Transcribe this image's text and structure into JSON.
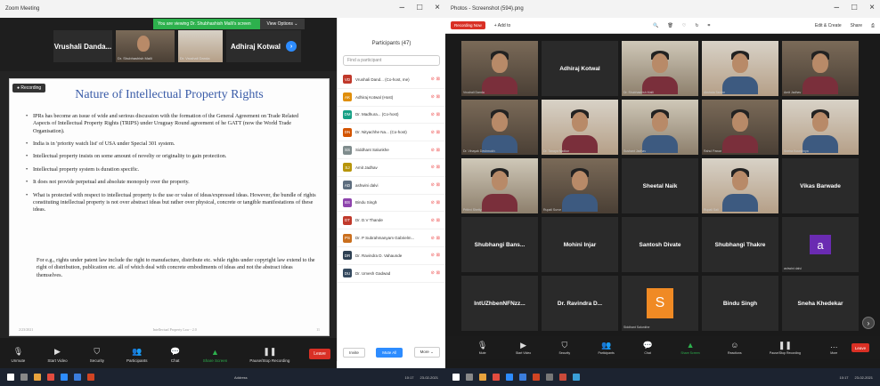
{
  "left": {
    "title": "Zoom Meeting",
    "banner": "You are viewing Dr. Shubhashish Malli's screen",
    "view_options": "View Options ⌄",
    "tiles": [
      {
        "label": "Vrushali Danda...",
        "name": ""
      },
      {
        "label": "",
        "name": "Dr. Shubhashish Malli"
      },
      {
        "label": "",
        "name": "Dr. Vrushali Danda"
      },
      {
        "label": "Adhiraj Kotwal",
        "name": ""
      }
    ],
    "recording": "Recording",
    "slide": {
      "title": "Nature of Intellectual Property Rights",
      "bullets": [
        "IPRs has become an issue of wide and serious discussion with the formation of the General Agreement on Trade Related Aspects of Intellectual Property Rights (TRIPS) under Uruguay Round agreement of he GATT (now the World Trade Organisation).",
        "India is in 'priority watch list' of USA under Special 301 system.",
        "Intellectual property insists on some amount of novelty or originality to gain protection.",
        "Intellectual property system is duration specific.",
        "It does not provide perpetual and absolute monopoly over the property.",
        "What is protected with respect to intellectual property is the use or value of ideas/expressed ideas. However, the bundle of rights constituting intellectual property is not over abstract ideas but rather over physical, concrete or tangible manifestations of these ideas."
      ],
      "sub": "For e.g., rights under patent law include the right to manufacture, distribute etc. while rights under copyright law extend to the right of distribution, publication etc. all of which deal with concrete embodiments of ideas and not the abstract ideas themselves.",
      "footer_left": "2/23/2021",
      "footer_mid": "Intellectual Property Law - 2.0",
      "footer_right": "11"
    },
    "toolbar": [
      {
        "label": "Unmute",
        "icon": "microphone-icon"
      },
      {
        "label": "Start Video",
        "icon": "video-icon"
      },
      {
        "label": "Security",
        "icon": "shield-icon"
      },
      {
        "label": "Participants",
        "icon": "people-icon"
      },
      {
        "label": "Chat",
        "icon": "chat-icon"
      },
      {
        "label": "Share Screen",
        "icon": "share-icon"
      },
      {
        "label": "Pause/Stop Recording",
        "icon": "record-icon"
      }
    ],
    "leave": "Leave",
    "panel": {
      "title": "Participants (47)",
      "search": "Find a participant",
      "participants": [
        {
          "initials": "VD",
          "name": "Vrushali Dand... (Co-host, me)",
          "color": "#c0392b"
        },
        {
          "initials": "AK",
          "name": "Adhiraj Kotwal (Host)",
          "color": "#e08e0b"
        },
        {
          "initials": "DM",
          "name": "Dr. Madhura... (Co-host)",
          "color": "#16a085"
        },
        {
          "initials": "DN",
          "name": "Dr. Nityachhe Na... (Co-host)",
          "color": "#d35400"
        },
        {
          "initials": "SS",
          "name": "Siddhant Salunkhe",
          "color": "#7f8c8d"
        },
        {
          "initials": "SJ",
          "name": "Amit Jadhav",
          "color": "#b7950b"
        },
        {
          "initials": "AD",
          "name": "ashwini dalvi",
          "color": "#5d6d7e"
        },
        {
          "initials": "BS",
          "name": "Bindu Singh",
          "color": "#8e44ad"
        },
        {
          "initials": "DT",
          "name": "Dr. D.V Thande",
          "color": "#c0392b"
        },
        {
          "initials": "PS",
          "name": "Dr. P Subrahmanyam Gabrielm...",
          "color": "#ca6f1e"
        },
        {
          "initials": "DR",
          "name": "Dr. Ravindra D. Vahaunde",
          "color": "#2e4053"
        },
        {
          "initials": "DU",
          "name": "Dr. Umesh Gadwad",
          "color": "#34495e"
        }
      ],
      "invite": "Invite",
      "mute_all": "Mute All",
      "more": "More ⌄"
    },
    "taskbar_text": "Address",
    "clock": "10:17",
    "date": "23-02-2021"
  },
  "right": {
    "title": "Photos - Screenshot (594).png",
    "record_btn": "Recording Now",
    "add": "+ Add to",
    "edit_create": "Edit & Create",
    "share": "Share",
    "tiles": [
      {
        "label": "",
        "name": "Vrushali Danda",
        "kind": "photo"
      },
      {
        "label": "Adhiraj Kotwal",
        "name": "",
        "kind": "text"
      },
      {
        "label": "",
        "name": "Dr. Shubhashish Malli",
        "kind": "photo2"
      },
      {
        "label": "",
        "name": "Akshata Tambe",
        "kind": "photo3"
      },
      {
        "label": "",
        "name": "Amit Jadhav",
        "kind": "photo"
      },
      {
        "label": "",
        "name": "Dr. Vinayak Deshmukh",
        "kind": "photo"
      },
      {
        "label": "",
        "name": "Dr. Tanaya Nadkar",
        "kind": "photo3"
      },
      {
        "label": "",
        "name": "Sushant Jadhav",
        "kind": "photo2"
      },
      {
        "label": "",
        "name": "Rahul Pawar",
        "kind": "photo"
      },
      {
        "label": "",
        "name": "Sneha Koundinya",
        "kind": "photo3"
      },
      {
        "label": "",
        "name": "Prithvi Shetty",
        "kind": "photo2"
      },
      {
        "label": "",
        "name": "Rupali Surve",
        "kind": "photo"
      },
      {
        "label": "Sheetal Naik",
        "name": "",
        "kind": "text"
      },
      {
        "label": "",
        "name": "Rupali Sali",
        "kind": "photo3"
      },
      {
        "label": "Vikas Barwade",
        "name": "",
        "kind": "text"
      },
      {
        "label": "Shubhangi Bans...",
        "name": "",
        "kind": "text"
      },
      {
        "label": "Mohini Injar",
        "name": "",
        "kind": "text"
      },
      {
        "label": "Santosh Divate",
        "name": "",
        "kind": "text"
      },
      {
        "label": "Shubhangi Thakre",
        "name": "",
        "kind": "text"
      },
      {
        "label": "a",
        "name": "ashwini dalvi",
        "kind": "letter-a"
      },
      {
        "label": "IntUZhbenNFNzz...",
        "name": "",
        "kind": "text"
      },
      {
        "label": "Dr. Ravindra D...",
        "name": "",
        "kind": "text"
      },
      {
        "label": "S",
        "name": "Siddhant Salunkhe",
        "kind": "letter-s"
      },
      {
        "label": "Bindu Singh",
        "name": "",
        "kind": "text"
      },
      {
        "label": "Sneha Khedekar",
        "name": "",
        "kind": "text"
      }
    ],
    "toolbar": [
      {
        "label": "Mute",
        "icon": "microphone-icon"
      },
      {
        "label": "Start Video",
        "icon": "video-icon"
      },
      {
        "label": "Security",
        "icon": "shield-icon"
      },
      {
        "label": "Participants",
        "icon": "people-icon"
      },
      {
        "label": "Chat",
        "icon": "chat-icon"
      },
      {
        "label": "Share Screen",
        "icon": "share-icon"
      },
      {
        "label": "Reactions",
        "icon": "smile-icon"
      },
      {
        "label": "Pause/Stop Recording",
        "icon": "record-icon"
      },
      {
        "label": "More",
        "icon": "more-icon"
      }
    ],
    "leave": "Leave",
    "clock": "10:17",
    "date": "23-02-2021"
  }
}
